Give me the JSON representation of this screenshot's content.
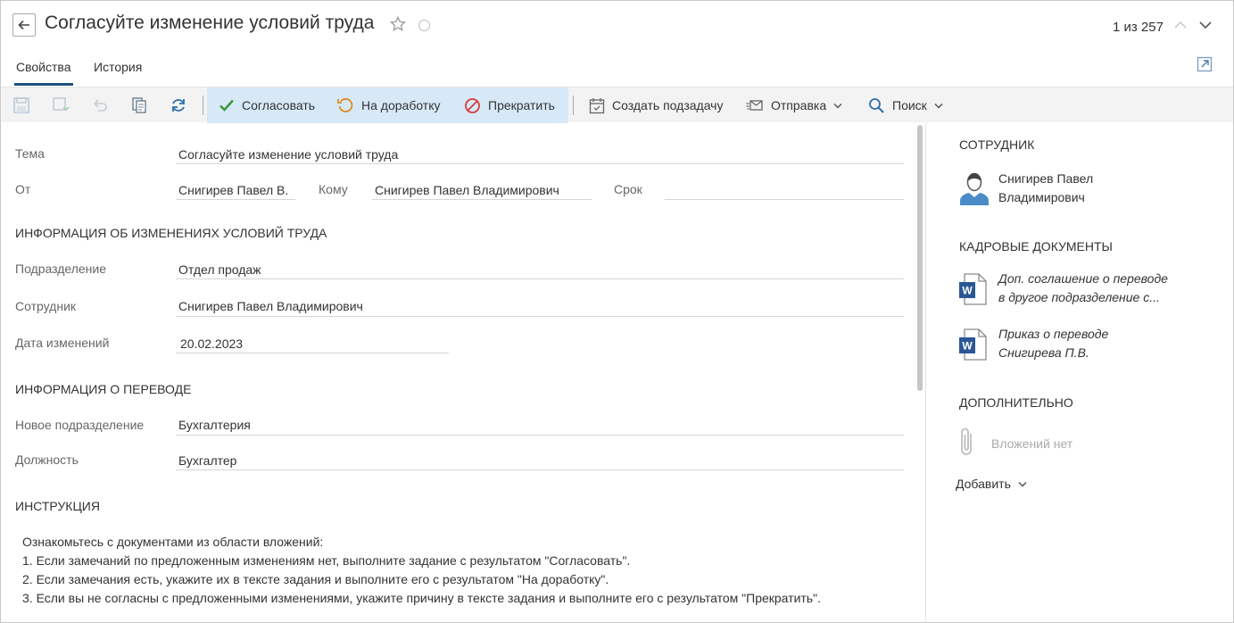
{
  "header": {
    "title": "Согласуйте изменение условий труда",
    "pager": "1 из 257"
  },
  "tabs": [
    {
      "label": "Свойства",
      "active": true
    },
    {
      "label": "История",
      "active": false
    }
  ],
  "toolbar": {
    "approve": "Согласовать",
    "rework": "На доработку",
    "stop": "Прекратить",
    "subtask": "Создать подзадачу",
    "send": "Отправка",
    "search": "Поиск"
  },
  "form": {
    "subject_label": "Тема",
    "subject_value": "Согласуйте изменение условий труда",
    "from_label": "От",
    "from_value": "Снигирев Павел В.",
    "to_label": "Кому",
    "to_value": "Снигирев Павел Владимирович",
    "due_label": "Срок",
    "due_value": "",
    "section_changes": "ИНФОРМАЦИЯ ОБ ИЗМЕНЕНИЯХ УСЛОВИЙ ТРУДА",
    "dept_label": "Подразделение",
    "dept_value": "Отдел продаж",
    "employee_label": "Сотрудник",
    "employee_value": "Снигирев Павел Владимирович",
    "date_label": "Дата изменений",
    "date_value": "20.02.2023",
    "section_transfer": "ИНФОРМАЦИЯ О ПЕРЕВОДЕ",
    "newdept_label": "Новое подразделение",
    "newdept_value": "Бухгалтерия",
    "position_label": "Должность",
    "position_value": "Бухгалтер",
    "section_instruction": "ИНСТРУКЦИЯ",
    "instruction_lines": [
      "Ознакомьтесь с документами из области вложений:",
      "1. Если замечаний по предложенным изменениям нет, выполните задание с результатом \"Согласовать\".",
      "2. Если замечания есть, укажите их в тексте задания и выполните его с результатом \"На доработку\".",
      "3. Если вы не согласны с предложенными изменениями, укажите причину в тексте задания и выполните его с результатом \"Прекратить\"."
    ]
  },
  "right_panel": {
    "employee_title": "СОТРУДНИК",
    "employee_line1": "Снигирев Павел",
    "employee_line2": "Владимирович",
    "hr_docs_title": "КАДРОВЫЕ ДОКУМЕНТЫ",
    "doc1_line1": "Доп. соглашение о переводе",
    "doc1_line2": "в другое подразделение с...",
    "doc2_line1": "Приказ о переводе",
    "doc2_line2": "Снигирева П.В.",
    "extra_title": "ДОПОЛНИТЕЛЬНО",
    "no_attachments": "Вложений нет",
    "add": "Добавить"
  },
  "colors": {
    "accent": "#1e4f80",
    "toolbar_bg": "#f3f3f3",
    "highlight_bg": "#d7e9f7",
    "word_blue": "#2b5797",
    "approve_green": "#3d9a3d",
    "rework_orange": "#e08a1e",
    "stop_red": "#d63b3b"
  }
}
